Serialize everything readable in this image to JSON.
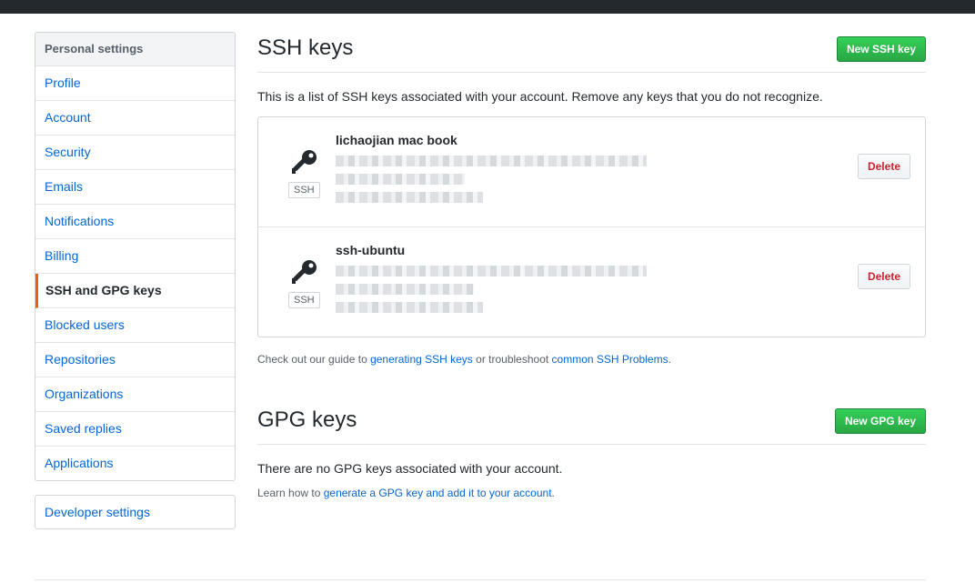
{
  "sidebar": {
    "heading": "Personal settings",
    "items": [
      {
        "label": "Profile"
      },
      {
        "label": "Account"
      },
      {
        "label": "Security"
      },
      {
        "label": "Emails"
      },
      {
        "label": "Notifications"
      },
      {
        "label": "Billing"
      },
      {
        "label": "SSH and GPG keys",
        "selected": true
      },
      {
        "label": "Blocked users"
      },
      {
        "label": "Repositories"
      },
      {
        "label": "Organizations"
      },
      {
        "label": "Saved replies"
      },
      {
        "label": "Applications"
      }
    ],
    "developer": "Developer settings"
  },
  "ssh": {
    "title": "SSH keys",
    "new_button": "New SSH key",
    "intro": "This is a list of SSH keys associated with your account. Remove any keys that you do not recognize.",
    "keys": [
      {
        "title": "lichaojian mac book",
        "badge": "SSH",
        "delete_label": "Delete",
        "icon": "key-icon"
      },
      {
        "title": "ssh-ubuntu",
        "badge": "SSH",
        "delete_label": "Delete",
        "icon": "key-icon"
      }
    ],
    "guide": {
      "prefix": "Check out our guide to ",
      "link1": "generating SSH keys",
      "middle": " or troubleshoot ",
      "link2": "common SSH Problems",
      "suffix": "."
    }
  },
  "gpg": {
    "title": "GPG keys",
    "new_button": "New GPG key",
    "empty": "There are no GPG keys associated with your account.",
    "learn": {
      "prefix": "Learn how to ",
      "link": "generate a GPG key and add it to your account",
      "suffix": "."
    }
  },
  "colors": {
    "accent": "#e36209",
    "link": "#0366d6",
    "primary_button": "#28a745",
    "danger": "#cb2431"
  }
}
